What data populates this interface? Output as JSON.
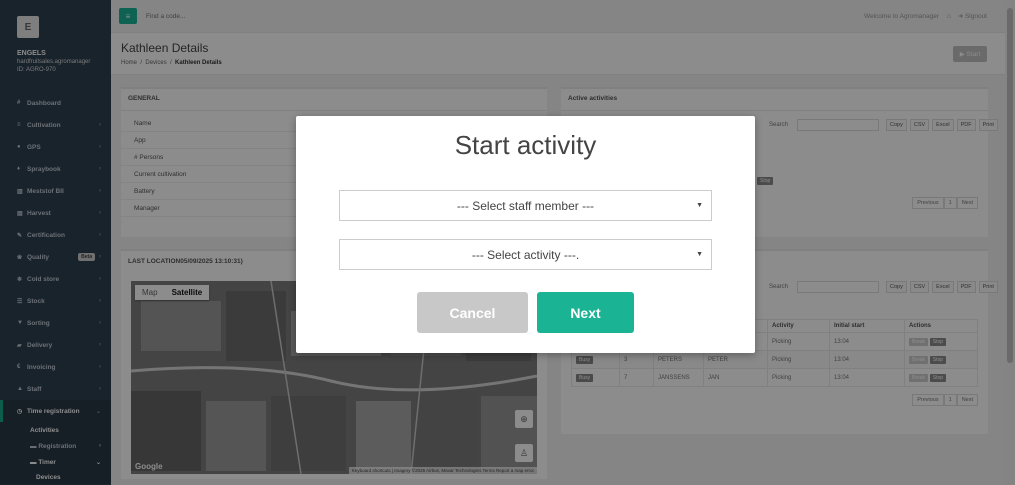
{
  "sidebar": {
    "logo": "E",
    "company": "ENGELS",
    "account": "hardfruitsales.agromanager",
    "id": "ID: AGRO-970",
    "items": [
      {
        "icon": "#",
        "label": "Dashboard"
      },
      {
        "icon": "≡",
        "label": "Cultivation"
      },
      {
        "icon": "●",
        "label": "GPS"
      },
      {
        "icon": "♦",
        "label": "Spraybook"
      },
      {
        "icon": "▥",
        "label": "Meststof BII"
      },
      {
        "icon": "▤",
        "label": "Harvest"
      },
      {
        "icon": "✎",
        "label": "Certification"
      },
      {
        "icon": "❀",
        "label": "Quality",
        "badge": "Beta"
      },
      {
        "icon": "❄",
        "label": "Cold store"
      },
      {
        "icon": "☰",
        "label": "Stock"
      },
      {
        "icon": "▼",
        "label": "Sorting"
      },
      {
        "icon": "▰",
        "label": "Delivery"
      },
      {
        "icon": "€",
        "label": "Invoicing"
      },
      {
        "icon": "▲",
        "label": "Staff"
      },
      {
        "icon": "◷",
        "label": "Time registration"
      }
    ],
    "sub": {
      "activities": "Activities",
      "registration": "Registration",
      "timer": "Timer",
      "devices": "Devices"
    }
  },
  "topbar": {
    "menu_icon": "≡",
    "search_placeholder": "Find a code...",
    "welcome": "Welcome to Agromanager",
    "home_icon": "⌂",
    "signout": "➜ Signout"
  },
  "heading": {
    "title": "Kathleen Details",
    "breadcrumb": [
      "Home",
      "Devices",
      "Kathleen Details"
    ],
    "start_button": "▶ Start"
  },
  "general": {
    "title": "GENERAL",
    "rows": [
      "Name",
      "App",
      "# Persons",
      "Current cultivation",
      "Battery",
      "Manager"
    ]
  },
  "active": {
    "title": "Active activities",
    "search_label": "Search",
    "tools": [
      "Copy",
      "CSV",
      "Excel",
      "PDF",
      "Print"
    ],
    "stop": "Stop",
    "pager": [
      "Previous",
      "1",
      "Next"
    ]
  },
  "location": {
    "title": "LAST LOCATION05/09/2025 13:10:31)",
    "map_types": [
      "Map",
      "Satellite"
    ],
    "google": "Google",
    "attribution": "Keyboard shortcuts | Imagery ©2025 Airbus, Maxar Technologies   Terms   Report a map error"
  },
  "staff": {
    "search_label": "Search",
    "tools": [
      "Copy",
      "CSV",
      "Excel",
      "PDF",
      "Print"
    ],
    "headers": [
      "",
      "",
      "",
      "",
      "Activity",
      "Initial start",
      "Actions"
    ],
    "rows": [
      {
        "status": "",
        "no": "",
        "last": "",
        "first": "",
        "activity": "Picking",
        "start": "13:04"
      },
      {
        "status": "Busy",
        "no": "3",
        "last": "PETERS",
        "first": "PETER",
        "activity": "Picking",
        "start": "13:04"
      },
      {
        "status": "Busy",
        "no": "7",
        "last": "JANSSENS",
        "first": "JAN",
        "activity": "Picking",
        "start": "13:04"
      }
    ],
    "break": "Break",
    "stop": "Stop",
    "pager": [
      "Previous",
      "1",
      "Next"
    ]
  },
  "modal": {
    "title": "Start activity",
    "staff_select": "--- Select staff member ---",
    "activity_select": "--- Select activity ---.",
    "cancel": "Cancel",
    "next": "Next"
  }
}
